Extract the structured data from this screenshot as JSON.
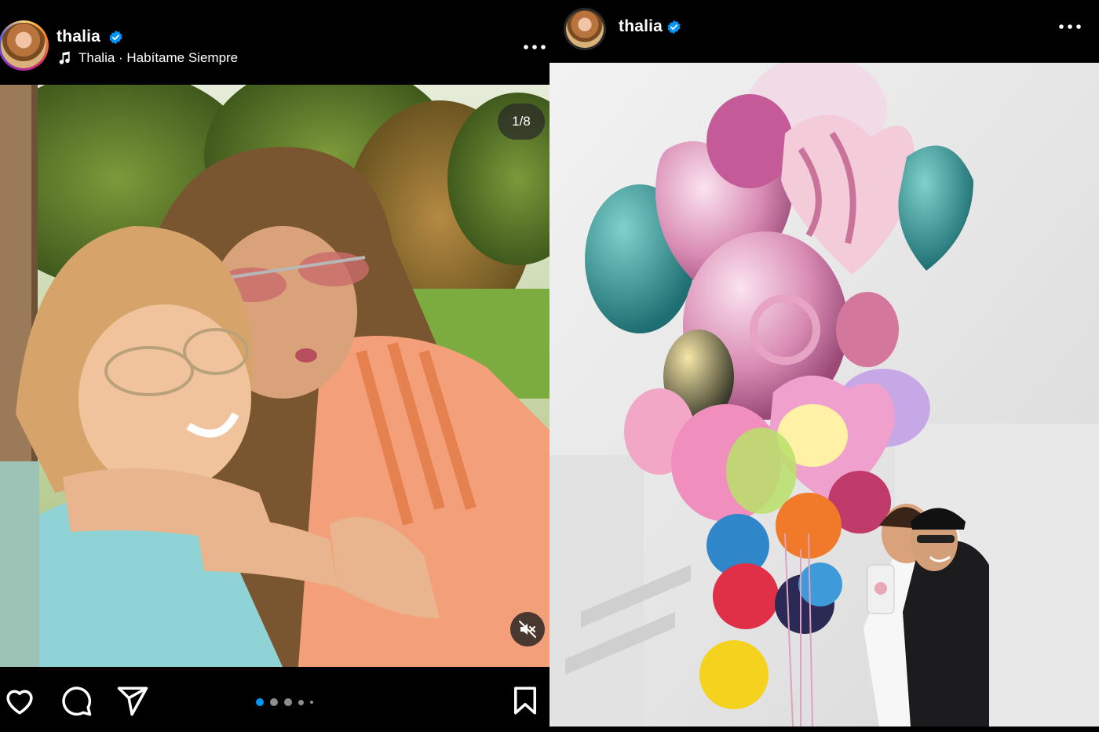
{
  "left_post": {
    "username": "thalia",
    "verified": true,
    "music_label": "Thalia · Habítame Siempre",
    "carousel_counter": "1/8",
    "carousel_dots": 5,
    "active_dot": 0,
    "icons": [
      "heart-icon",
      "comment-icon",
      "share-icon",
      "bookmark-icon",
      "mute-icon",
      "more-icon",
      "music-note-icon",
      "verified-badge-icon"
    ]
  },
  "right_post": {
    "username": "thalia",
    "verified": true,
    "icons": [
      "more-icon",
      "verified-badge-icon"
    ]
  },
  "colors": {
    "background": "#000000",
    "text": "#ffffff",
    "verified_blue": "#0095f6",
    "dot_active": "#0095f6",
    "dot_inactive": "#8e8e8e"
  }
}
